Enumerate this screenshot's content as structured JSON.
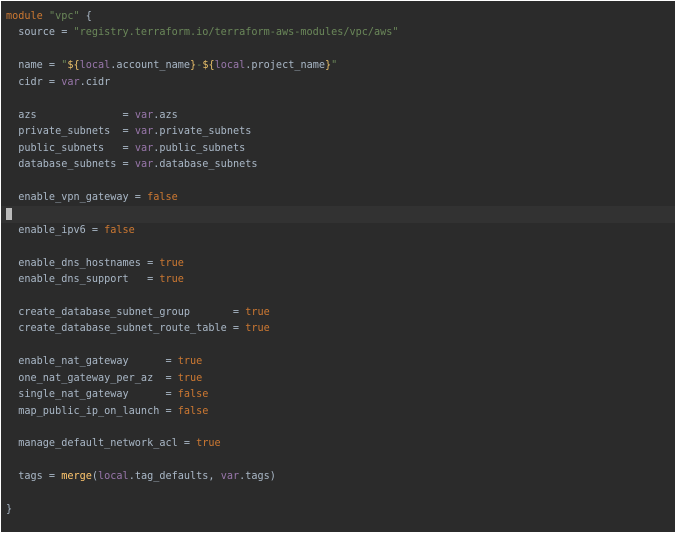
{
  "editor": {
    "lines": [
      {
        "parts": [
          {
            "t": "module ",
            "c": "kw"
          },
          {
            "t": "\"vpc\"",
            "c": "str"
          },
          {
            "t": " {",
            "c": "punc"
          }
        ]
      },
      {
        "parts": [
          {
            "t": "  source = ",
            "c": "punc"
          },
          {
            "t": "\"registry.terraform.io/terraform-aws-modules/vpc/aws\"",
            "c": "str"
          }
        ]
      },
      {
        "parts": []
      },
      {
        "parts": [
          {
            "t": "  name = ",
            "c": "punc"
          },
          {
            "t": "\"",
            "c": "str"
          },
          {
            "t": "${",
            "c": "interp"
          },
          {
            "t": "local",
            "c": "loc"
          },
          {
            "t": ".account_name",
            "c": "punc"
          },
          {
            "t": "}",
            "c": "interp"
          },
          {
            "t": "-",
            "c": "str"
          },
          {
            "t": "${",
            "c": "interp"
          },
          {
            "t": "local",
            "c": "loc"
          },
          {
            "t": ".project_name",
            "c": "punc"
          },
          {
            "t": "}",
            "c": "interp"
          },
          {
            "t": "\"",
            "c": "str"
          }
        ]
      },
      {
        "parts": [
          {
            "t": "  cidr = ",
            "c": "punc"
          },
          {
            "t": "var",
            "c": "loc"
          },
          {
            "t": ".cidr",
            "c": "punc"
          }
        ]
      },
      {
        "parts": []
      },
      {
        "parts": [
          {
            "t": "  azs              = ",
            "c": "punc"
          },
          {
            "t": "var",
            "c": "loc"
          },
          {
            "t": ".azs",
            "c": "punc"
          }
        ]
      },
      {
        "parts": [
          {
            "t": "  private_subnets  = ",
            "c": "punc"
          },
          {
            "t": "var",
            "c": "loc"
          },
          {
            "t": ".private_subnets",
            "c": "punc"
          }
        ]
      },
      {
        "parts": [
          {
            "t": "  public_subnets   = ",
            "c": "punc"
          },
          {
            "t": "var",
            "c": "loc"
          },
          {
            "t": ".public_subnets",
            "c": "punc"
          }
        ]
      },
      {
        "parts": [
          {
            "t": "  database_subnets = ",
            "c": "punc"
          },
          {
            "t": "var",
            "c": "loc"
          },
          {
            "t": ".database_subnets",
            "c": "punc"
          }
        ]
      },
      {
        "parts": []
      },
      {
        "parts": [
          {
            "t": "  enable_vpn_gateway = ",
            "c": "punc"
          },
          {
            "t": "false",
            "c": "bool"
          }
        ]
      },
      {
        "parts": [],
        "current": true
      },
      {
        "parts": [
          {
            "t": "  enable_ipv6 = ",
            "c": "punc"
          },
          {
            "t": "false",
            "c": "bool"
          }
        ]
      },
      {
        "parts": []
      },
      {
        "parts": [
          {
            "t": "  enable_dns_hostnames = ",
            "c": "punc"
          },
          {
            "t": "true",
            "c": "bool"
          }
        ]
      },
      {
        "parts": [
          {
            "t": "  enable_dns_support   = ",
            "c": "punc"
          },
          {
            "t": "true",
            "c": "bool"
          }
        ]
      },
      {
        "parts": []
      },
      {
        "parts": [
          {
            "t": "  create_database_subnet_group       = ",
            "c": "punc"
          },
          {
            "t": "true",
            "c": "bool"
          }
        ]
      },
      {
        "parts": [
          {
            "t": "  create_database_subnet_route_table = ",
            "c": "punc"
          },
          {
            "t": "true",
            "c": "bool"
          }
        ]
      },
      {
        "parts": []
      },
      {
        "parts": [
          {
            "t": "  enable_nat_gateway      = ",
            "c": "punc"
          },
          {
            "t": "true",
            "c": "bool"
          }
        ]
      },
      {
        "parts": [
          {
            "t": "  one_nat_gateway_per_az  = ",
            "c": "punc"
          },
          {
            "t": "true",
            "c": "bool"
          }
        ]
      },
      {
        "parts": [
          {
            "t": "  single_nat_gateway      = ",
            "c": "punc"
          },
          {
            "t": "false",
            "c": "bool"
          }
        ]
      },
      {
        "parts": [
          {
            "t": "  map_public_ip_on_launch = ",
            "c": "punc"
          },
          {
            "t": "false",
            "c": "bool"
          }
        ]
      },
      {
        "parts": []
      },
      {
        "parts": [
          {
            "t": "  manage_default_network_acl = ",
            "c": "punc"
          },
          {
            "t": "true",
            "c": "bool"
          }
        ]
      },
      {
        "parts": []
      },
      {
        "parts": [
          {
            "t": "  tags = ",
            "c": "punc"
          },
          {
            "t": "merge",
            "c": "fn"
          },
          {
            "t": "(",
            "c": "punc"
          },
          {
            "t": "local",
            "c": "loc"
          },
          {
            "t": ".tag_defaults, ",
            "c": "punc"
          },
          {
            "t": "var",
            "c": "loc"
          },
          {
            "t": ".tags)",
            "c": "punc"
          }
        ]
      },
      {
        "parts": []
      },
      {
        "parts": [
          {
            "t": "}",
            "c": "punc"
          }
        ]
      }
    ]
  },
  "colors": {
    "background": "#2b2b2b",
    "current_line": "#323232",
    "keyword": "#cc7832",
    "string": "#6a8759",
    "text": "#a9b7c6"
  }
}
